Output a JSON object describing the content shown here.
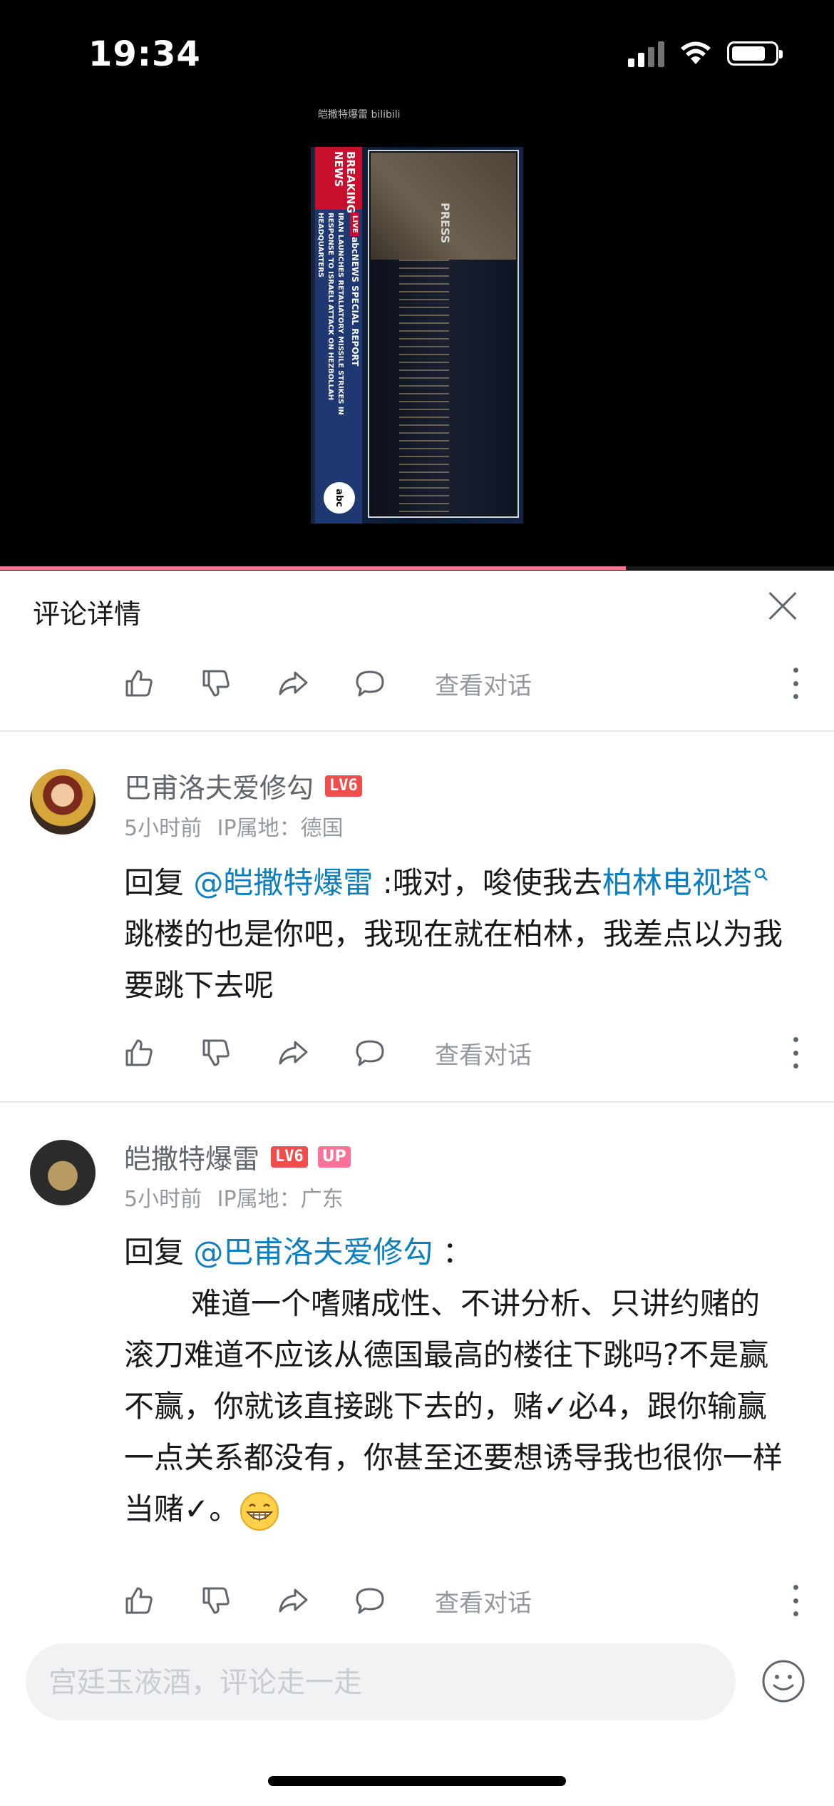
{
  "status_bar": {
    "time": "19:34"
  },
  "video": {
    "watermark": "皑撒特爆雷 bilibili",
    "breaking": "BREAKING NEWS",
    "live": "LIVE",
    "special_report": "abcNEWS SPECIAL REPORT",
    "ticker": "IRAN LAUNCHES RETALIATORY MISSILE STRIKES IN RESPONSE TO ISRAELI ATTACK ON HEZBOLLAH HEADQUARTERS",
    "press": "PRESS",
    "logo": "abc",
    "progress": 0.75
  },
  "panel": {
    "title": "评论详情"
  },
  "actions": {
    "view_conversation": "查看对话"
  },
  "comments": [
    {
      "username": "巴甫洛夫爱修勾",
      "level": "LV6",
      "time": "5小时前",
      "location": "IP属地：德国",
      "reply_prefix": "回复",
      "mention": "@皑撒特爆雷",
      "text_a": ":哦对，唆使我去",
      "link": "柏林电视塔",
      "text_b": "跳楼的也是你吧，我现在就在柏林，我差点以为我要跳下去呢"
    },
    {
      "username": "皑撒特爆雷",
      "level": "LV6",
      "badge": "UP",
      "time": "5小时前",
      "location": "IP属地：广东",
      "reply_prefix": "回复",
      "mention": "@巴甫洛夫爱修勾",
      "colon": "：",
      "body": "难道一个嗜赌成性、不讲分析、只讲约赌的滚刀难道不应该从德国最高的楼往下跳吗?不是赢不赢，你就该直接跳下去的，赌✓必4，跟你输赢一点关系都没有，你甚至还要想诱导我也很你一样当赌✓。"
    }
  ],
  "input": {
    "placeholder": "宫廷玉液酒，评论走一走"
  },
  "colors": {
    "accent": "#fb7299",
    "link": "#0b7fbf",
    "level": "#f04d4d"
  }
}
